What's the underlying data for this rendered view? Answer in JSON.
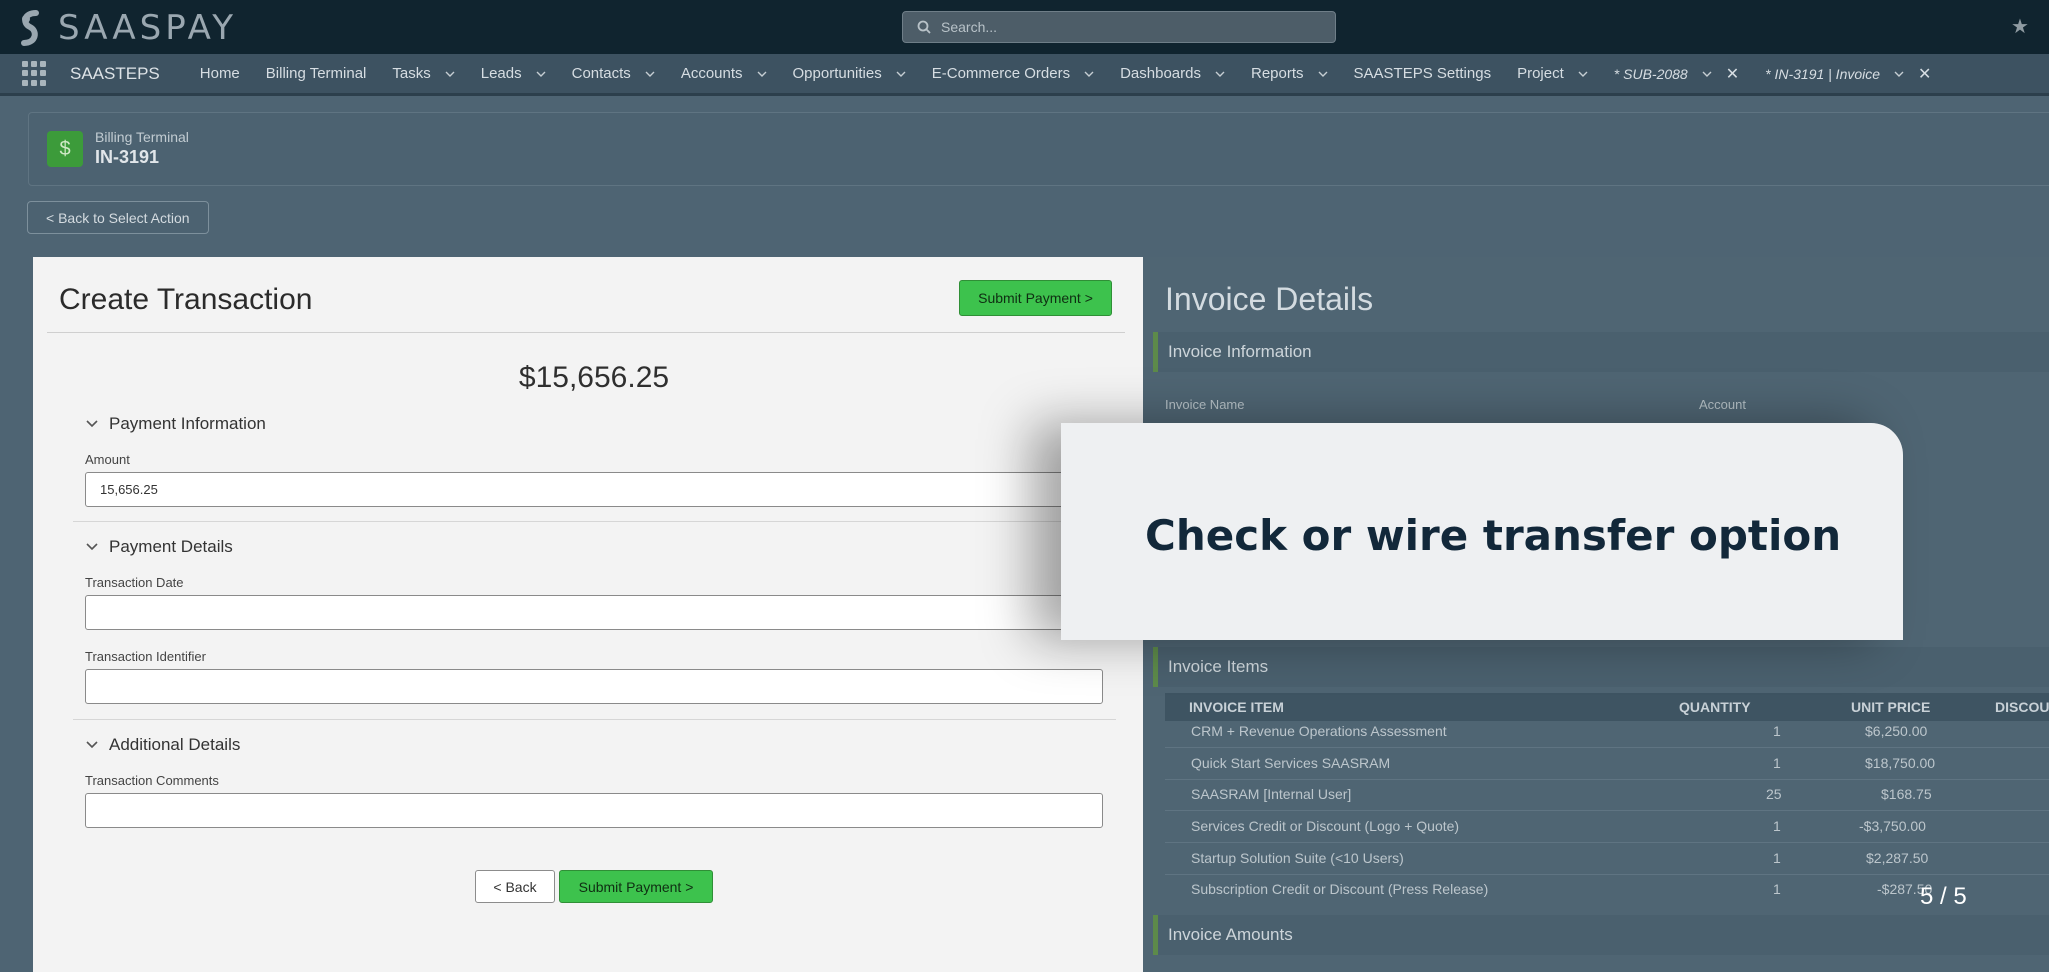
{
  "topbar": {
    "logo_text": "SAASPAY",
    "search_placeholder": "Search...",
    "star_icon": "star-icon"
  },
  "nav": {
    "app_name": "SAASTEPS",
    "items": [
      {
        "label": "Home",
        "has_chevron": false
      },
      {
        "label": "Billing Terminal",
        "has_chevron": false
      },
      {
        "label": "Tasks",
        "has_chevron": true
      },
      {
        "label": "Leads",
        "has_chevron": true
      },
      {
        "label": "Contacts",
        "has_chevron": true
      },
      {
        "label": "Accounts",
        "has_chevron": true
      },
      {
        "label": "Opportunities",
        "has_chevron": true
      },
      {
        "label": "E-Commerce Orders",
        "has_chevron": true
      },
      {
        "label": "Dashboards",
        "has_chevron": true
      },
      {
        "label": "Reports",
        "has_chevron": true
      },
      {
        "label": "SAASTEPS Settings",
        "has_chevron": false
      },
      {
        "label": "Project",
        "has_chevron": true
      }
    ],
    "tabs": [
      {
        "label": "* SUB-2088"
      },
      {
        "label": "* IN-3191 | Invoice"
      }
    ]
  },
  "header": {
    "subtitle": "Billing Terminal",
    "title": "IN-3191"
  },
  "back_select_label": "< Back to Select Action",
  "transaction": {
    "title": "Create Transaction",
    "submit_label": "Submit Payment >",
    "total": "$15,656.25",
    "sections": {
      "payment_info": "Payment Information",
      "payment_details": "Payment Details",
      "additional_details": "Additional Details"
    },
    "fields": {
      "amount_label": "Amount",
      "amount_value": "15,656.25",
      "date_label": "Transaction Date",
      "date_value": "",
      "identifier_label": "Transaction Identifier",
      "identifier_value": "",
      "comments_label": "Transaction Comments",
      "comments_value": ""
    },
    "back_label": "< Back",
    "submit_bottom_label": "Submit Payment >"
  },
  "invoice": {
    "title": "Invoice Details",
    "info_section": "Invoice Information",
    "name_label": "Invoice Name",
    "account_label": "Account",
    "items_section": "Invoice Items",
    "columns": [
      "INVOICE ITEM",
      "QUANTITY",
      "UNIT PRICE",
      "DISCOU"
    ],
    "rows": [
      {
        "item": "CRM + Revenue Operations Assessment",
        "qty": "1",
        "price": "$6,250.00"
      },
      {
        "item": "Quick Start Services SAASRAM",
        "qty": "1",
        "price": "$18,750.00"
      },
      {
        "item": "SAASRAM [Internal User]",
        "qty": "25",
        "price": "$168.75"
      },
      {
        "item": "Services Credit or Discount (Logo + Quote)",
        "qty": "1",
        "price": "-$3,750.00"
      },
      {
        "item": "Startup Solution Suite (<10 Users)",
        "qty": "1",
        "price": "$2,287.50"
      },
      {
        "item": "Subscription Credit or Discount (Press Release)",
        "qty": "1",
        "price": "-$287.50"
      }
    ],
    "amounts_section": "Invoice Amounts"
  },
  "overlay": {
    "caption": "Check or wire transfer option"
  },
  "pager": "5 / 5"
}
